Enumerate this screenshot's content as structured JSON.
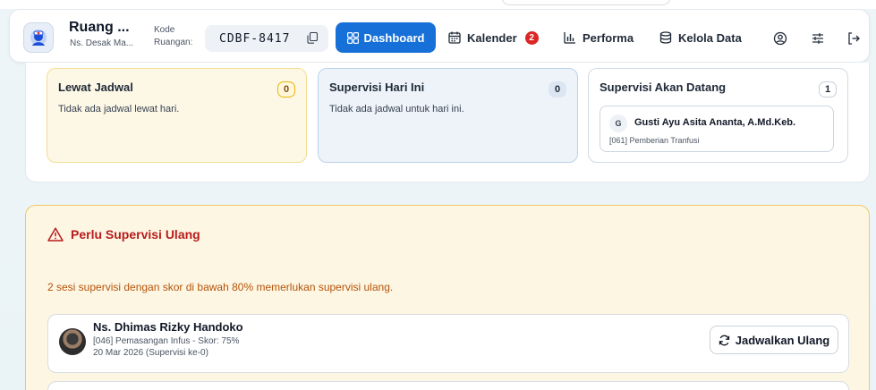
{
  "header": {
    "room_name": "Ruang ...",
    "room_sub": "Ns. Desak Ma...",
    "code_label_1": "Kode",
    "code_label_2": "Ruangan:",
    "room_code": "CDBF-8417",
    "nav": {
      "dashboard": "Dashboard",
      "kalender": "Kalender",
      "kalender_badge": "2",
      "performa": "Performa",
      "kelola": "Kelola Data"
    }
  },
  "summary": {
    "lewat": {
      "title": "Lewat Jadwal",
      "count": "0",
      "empty": "Tidak ada jadwal lewat hari."
    },
    "hari_ini": {
      "title": "Supervisi Hari Ini",
      "count": "0",
      "empty": "Tidak ada jadwal untuk hari ini."
    },
    "akan": {
      "title": "Supervisi Akan Datang",
      "count": "1",
      "items": [
        {
          "initial": "G",
          "name": "Gusti Ayu Asita Ananta, A.Md.Keb.",
          "procedure": "[061] Pemberian Tranfusi"
        }
      ]
    }
  },
  "resupervision": {
    "title": "Perlu Supervisi Ulang",
    "description": "2 sesi supervisi dengan skor di bawah 80% memerlukan supervisi ulang.",
    "items": [
      {
        "name": "Ns. Dhimas Rizky Handoko",
        "info": "[046] Pemasangan Infus - Skor: 75%",
        "date": "20 Mar 2026 (Supervisi ke-0)",
        "action": "Jadwalkan Ulang"
      }
    ]
  },
  "colors": {
    "primary": "#1670d8",
    "warning_text": "#b91c1c",
    "warning_bg": "#fdf6e3",
    "badge_red": "#dc2626"
  }
}
